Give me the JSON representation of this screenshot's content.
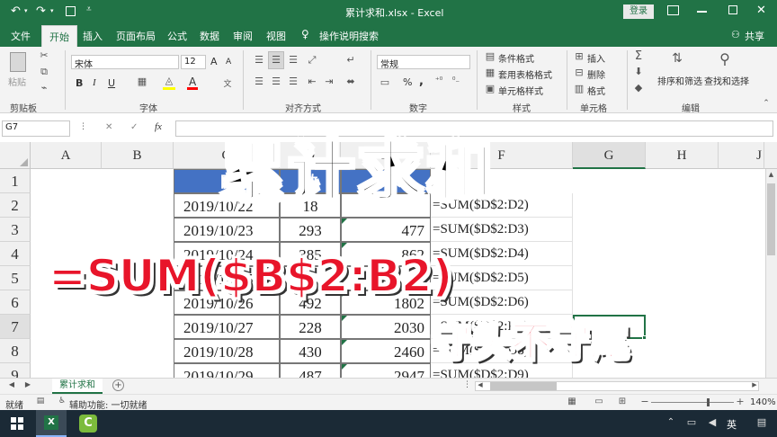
{
  "window": {
    "title": "累计求和.xlsx  -  Excel",
    "login_label": "登录"
  },
  "tabs": [
    "文件",
    "开始",
    "插入",
    "页面布局",
    "公式",
    "数据",
    "审阅",
    "视图"
  ],
  "tell_me": "操作说明搜索",
  "share_label": "共享",
  "ribbon": {
    "clipboard": {
      "paste": "粘贴",
      "label": "剪贴板"
    },
    "font": {
      "name": "宋体",
      "size": "12",
      "label": "字体",
      "bold": "B",
      "italic": "I",
      "underline": "U",
      "grow": "A",
      "font_color_letter": "A",
      "fill_color": "#ffff00",
      "font_color": "#ff0000"
    },
    "alignment": {
      "label": "对齐方式"
    },
    "number": {
      "format": "常规",
      "label": "数字",
      "percent": "%",
      "comma": ","
    },
    "styles": {
      "conditional": "条件格式",
      "table": "套用表格格式",
      "cell": "单元格样式",
      "label": "样式"
    },
    "cells": {
      "insert": "插入",
      "delete": "删除",
      "format": "格式",
      "label": "单元格"
    },
    "editing": {
      "sort": "排序和筛选",
      "find": "查找和选择",
      "label": "编辑"
    }
  },
  "formula_bar": {
    "name_box": "G7",
    "fx": "fx",
    "cancel": "✕",
    "confirm": "✓"
  },
  "columns": [
    "A",
    "B",
    "C",
    "D",
    "E",
    "F",
    "G",
    "H",
    "I",
    "J"
  ],
  "rows": [
    "1",
    "2",
    "3",
    "4",
    "5",
    "6",
    "7",
    "8",
    "9"
  ],
  "table": {
    "header": [
      "日",
      "数",
      "计求",
      ""
    ],
    "rows": [
      [
        "2019/10/22",
        "18",
        "",
        "=SUM($D$2:D2)"
      ],
      [
        "2019/10/23",
        "293",
        "477",
        "=SUM($D$2:D3)"
      ],
      [
        "2019/10/24",
        "385",
        "862",
        "=SUM($D$2:D4)"
      ],
      [
        "2019/10/25",
        "",
        "",
        "=SUM($D$2:D5)"
      ],
      [
        "2019/10/26",
        "492",
        "1802",
        "=SUM($D$2:D6)"
      ],
      [
        "2019/10/27",
        "228",
        "2030",
        "=SUM($D$2:D7)"
      ],
      [
        "2019/10/28",
        "430",
        "2460",
        "=SUM($D$2:D8)"
      ],
      [
        "2019/10/29",
        "487",
        "2947",
        "=SUM($D$2:D9)"
      ]
    ]
  },
  "overlay": {
    "title": "累计求和",
    "formula": "=SUM($B$2:B2)",
    "note": "守头不守尾"
  },
  "sheet": {
    "tab": "累计求和",
    "add": "+"
  },
  "status": {
    "ready": "就绪",
    "accessibility": "辅助功能: 一切就绪",
    "zoom": "140%"
  },
  "taskbar": {
    "lang": "英"
  },
  "colors": {
    "excel_green": "#217346",
    "header_blue": "#4472c4",
    "overlay_red": "#e8152a"
  }
}
